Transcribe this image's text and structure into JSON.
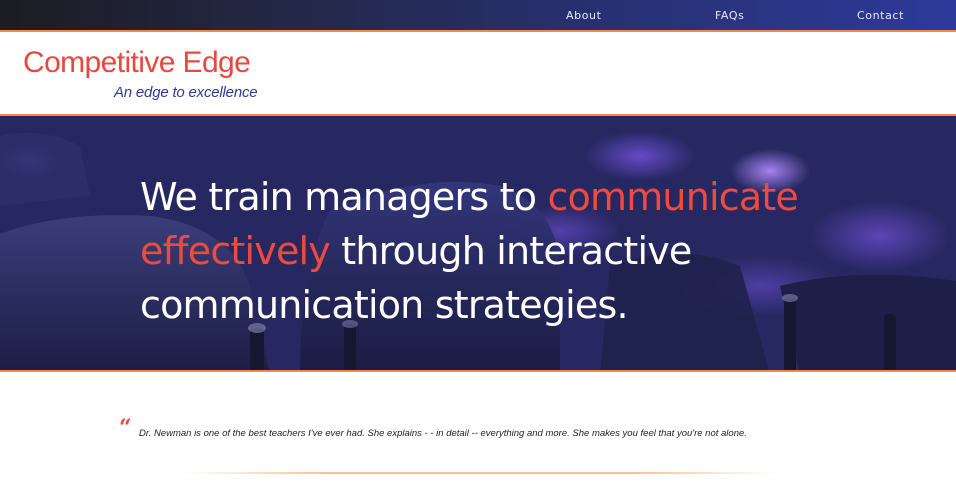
{
  "nav": {
    "about": "About",
    "faqs": "FAQs",
    "contact": "Contact"
  },
  "brand": {
    "title": "Competitive Edge",
    "tagline": "An edge to excellence"
  },
  "hero": {
    "text_1": "We train managers to ",
    "accent_1": "communicate",
    "accent_2": "effectively",
    "text_2": " through interactive",
    "text_3": "communication strategies."
  },
  "testimonial": {
    "mark": "“",
    "text": "Dr. Newman is one of the best teachers I've ever had. She explains - - in detail -- everything and more. She makes you feel that you're not alone."
  },
  "colors": {
    "accent_red": "#e8483d",
    "brand_blue": "#2f3892",
    "orange_rule": "#f08a4b"
  }
}
